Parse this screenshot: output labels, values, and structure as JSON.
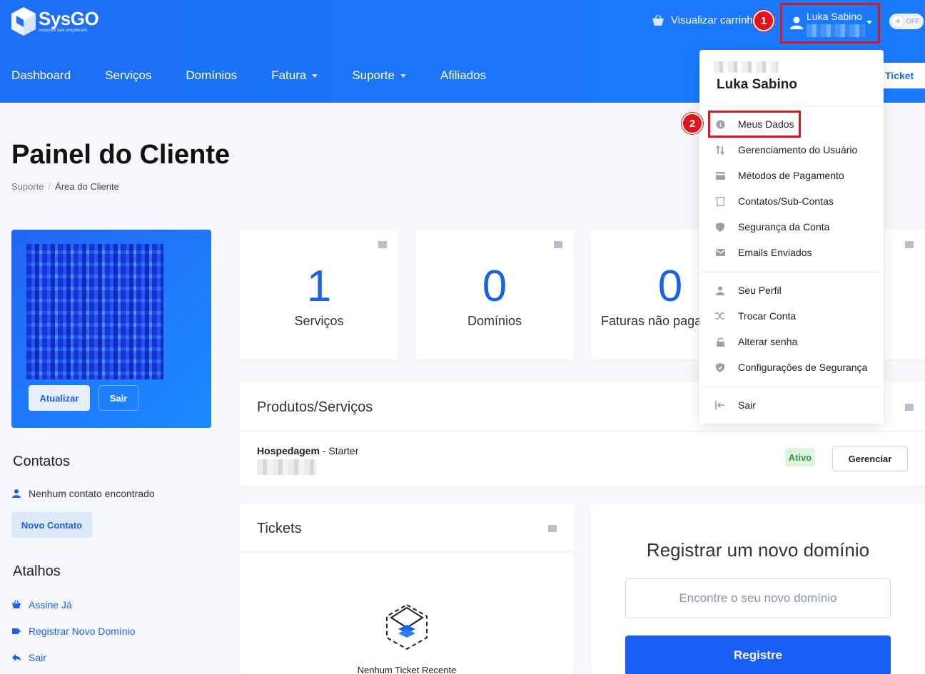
{
  "header": {
    "logo_name": "SysGO",
    "logo_tagline": "Soluções que simplificam",
    "cart_label": "Visualizar carrinho",
    "user_name": "Luka Sabino",
    "theme_toggle": "OFF",
    "ticket_button": "Ticket"
  },
  "nav": {
    "items": [
      {
        "label": "Dashboard",
        "dropdown": false
      },
      {
        "label": "Serviços",
        "dropdown": false
      },
      {
        "label": "Domínios",
        "dropdown": false
      },
      {
        "label": "Fatura",
        "dropdown": true
      },
      {
        "label": "Suporte",
        "dropdown": true
      },
      {
        "label": "Afiliados",
        "dropdown": false
      }
    ]
  },
  "annotations": {
    "step1": "1",
    "step2": "2",
    "highlight_color": "#e0151b"
  },
  "page": {
    "title": "Painel do Cliente",
    "breadcrumb": [
      "Suporte",
      "Área do Cliente"
    ]
  },
  "profile_card": {
    "update_button": "Atualizar",
    "exit_button": "Sair"
  },
  "contacts": {
    "heading": "Contatos",
    "empty_text": "Nenhum contato encontrado",
    "new_button": "Novo Contato"
  },
  "shortcuts": {
    "heading": "Atalhos",
    "items": [
      {
        "label": "Assine Já",
        "icon": "basket-icon"
      },
      {
        "label": "Registrar Novo Domínio",
        "icon": "tag-icon"
      },
      {
        "label": "Sair",
        "icon": "back-arrow-icon"
      }
    ]
  },
  "stats": [
    {
      "value": "1",
      "label": "Serviços",
      "icon": "server-icon"
    },
    {
      "value": "0",
      "label": "Domínios",
      "icon": "tag-icon"
    },
    {
      "value": "0",
      "label": "Faturas não pagas",
      "icon": "tag-icon"
    }
  ],
  "products": {
    "title": "Produtos/Serviços",
    "row": {
      "name": "Hospedagem",
      "plan": " - Starter",
      "status": "Ativo",
      "manage_button": "Gerenciar"
    }
  },
  "tickets": {
    "title": "Tickets",
    "empty_text": "Nenhum Ticket Recente"
  },
  "domain": {
    "title": "Registrar um novo domínio",
    "placeholder": "Encontre o seu novo domínio",
    "button": "Registre"
  },
  "dropdown": {
    "name": "Luka Sabino",
    "group1": [
      {
        "label": "Meus Dados",
        "icon": "info-icon"
      },
      {
        "label": "Gerenciamento do Usuário",
        "icon": "sort-arrows-icon"
      },
      {
        "label": "Métodos de Pagamento",
        "icon": "card-icon"
      },
      {
        "label": "Contatos/Sub-Contas",
        "icon": "address-book-icon"
      },
      {
        "label": "Segurança da Conta",
        "icon": "shield-icon"
      },
      {
        "label": "Emails Enviados",
        "icon": "envelope-icon"
      }
    ],
    "group2": [
      {
        "label": "Seu Perfil",
        "icon": "user-icon"
      },
      {
        "label": "Trocar Conta",
        "icon": "shuffle-icon"
      },
      {
        "label": "Alterar senha",
        "icon": "lock-icon"
      },
      {
        "label": "Configurações de Segurança",
        "icon": "shield-check-icon"
      }
    ],
    "group3": [
      {
        "label": "Sair",
        "icon": "logout-icon"
      }
    ]
  },
  "colors": {
    "primary": "#1a6ef5",
    "success": "#2f9a3c"
  }
}
